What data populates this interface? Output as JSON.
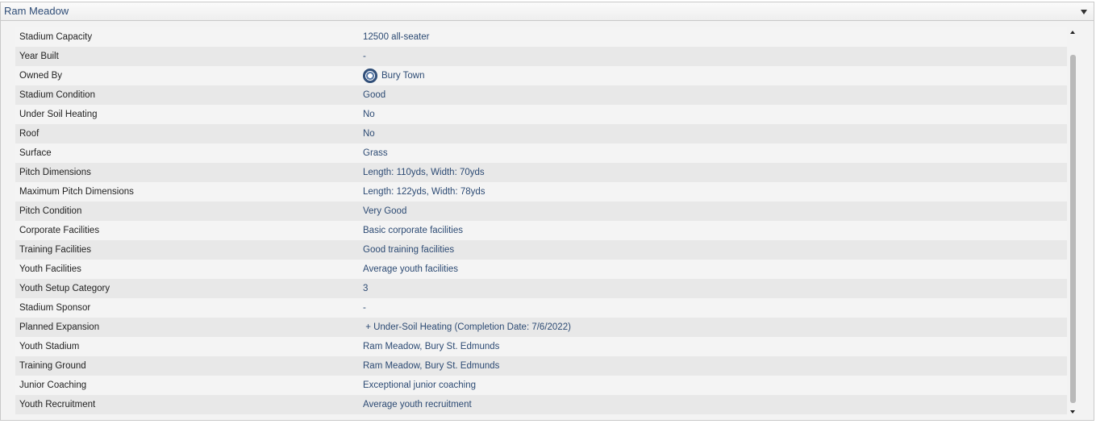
{
  "panel": {
    "title": "Ram Meadow"
  },
  "rows": [
    {
      "label": "Stadium Capacity",
      "value": "12500 all-seater"
    },
    {
      "label": "Year Built",
      "value": "-"
    },
    {
      "label": "Owned By",
      "value": "Bury Town",
      "icon": "club-crest-icon"
    },
    {
      "label": "Stadium Condition",
      "value": "Good"
    },
    {
      "label": "Under Soil Heating",
      "value": "No"
    },
    {
      "label": "Roof",
      "value": "No"
    },
    {
      "label": "Surface",
      "value": "Grass"
    },
    {
      "label": "Pitch Dimensions",
      "value": "Length: 110yds, Width: 70yds"
    },
    {
      "label": "Maximum Pitch Dimensions",
      "value": "Length: 122yds, Width: 78yds"
    },
    {
      "label": "Pitch Condition",
      "value": "Very Good"
    },
    {
      "label": "Corporate Facilities",
      "value": "Basic corporate facilities"
    },
    {
      "label": "Training Facilities",
      "value": "Good training facilities"
    },
    {
      "label": "Youth Facilities",
      "value": "Average youth facilities"
    },
    {
      "label": "Youth Setup Category",
      "value": "3"
    },
    {
      "label": "Stadium Sponsor",
      "value": "-"
    },
    {
      "label": "Planned Expansion",
      "value": " + Under-Soil Heating (Completion Date: 7/6/2022)"
    },
    {
      "label": "Youth Stadium",
      "value": "Ram Meadow, Bury St. Edmunds"
    },
    {
      "label": "Training Ground",
      "value": "Ram Meadow, Bury St. Edmunds"
    },
    {
      "label": "Junior Coaching",
      "value": "Exceptional junior coaching"
    },
    {
      "label": "Youth Recruitment",
      "value": "Average youth recruitment"
    }
  ],
  "colors": {
    "header_text": "#2f4d77",
    "value_text": "#2c4a73",
    "label_text": "#222222"
  }
}
